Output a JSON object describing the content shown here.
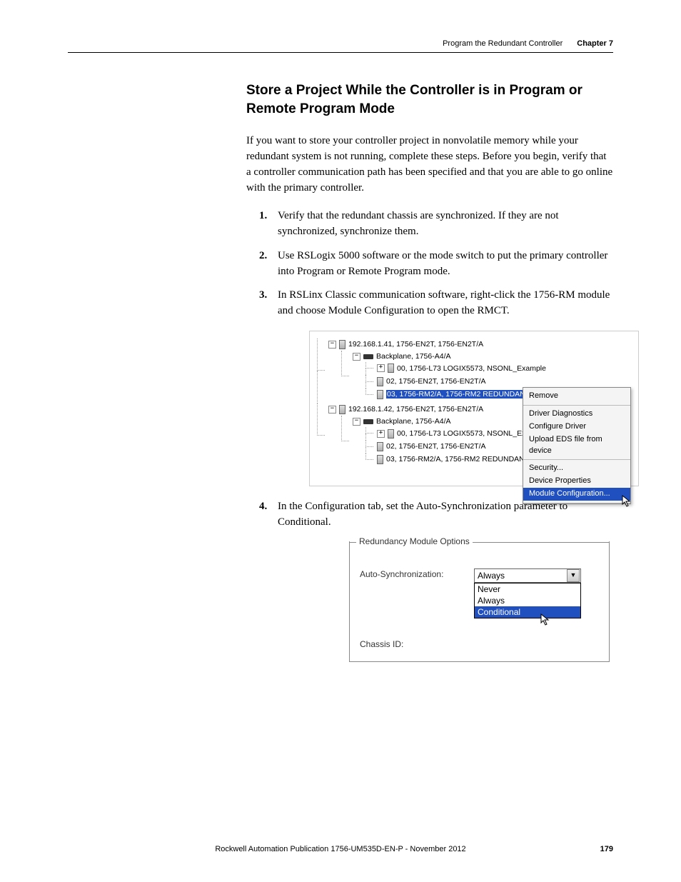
{
  "header": {
    "chapter_title": "Program the Redundant Controller",
    "chapter_label": "Chapter 7"
  },
  "section_title": "Store a Project While the Controller is in Program or Remote Program Mode",
  "intro": "If you want to store your controller project in nonvolatile memory while your redundant system is not running, complete these steps. Before you begin, verify that a controller communication path has been specified and that you are able to go online with the primary controller.",
  "steps": [
    "Verify that the redundant chassis are synchronized. If they are not synchronized, synchronize them.",
    "Use RSLogix 5000 software or the mode switch to put the primary controller into Program or Remote Program mode.",
    "In RSLinx Classic communication software, right-click the 1756-RM module and choose Module Configuration to open the RMCT.",
    "In the Configuration tab, set the Auto-Synchronization parameter to Conditional."
  ],
  "tree": {
    "node1": {
      "label": "192.168.1.41, 1756-EN2T, 1756-EN2T/A",
      "backplane": "Backplane, 1756-A4/A",
      "children": [
        "00, 1756-L73 LOGIX5573, NSONL_Example",
        "02, 1756-EN2T, 1756-EN2T/A",
        "03, 1756-RM2/A, 1756-RM2 REDUNDANCY MODULE"
      ]
    },
    "node2": {
      "label": "192.168.1.42, 1756-EN2T, 1756-EN2T/A",
      "backplane": "Backplane, 1756-A4/A",
      "children": [
        "00, 1756-L73 LOGIX5573, NSONL_Example",
        "02, 1756-EN2T, 1756-EN2T/A",
        "03, 1756-RM2/A, 1756-RM2 REDUNDANCY MODULE"
      ]
    }
  },
  "context_menu": {
    "g1": [
      "Remove"
    ],
    "g2": [
      "Driver Diagnostics",
      "Configure Driver",
      "Upload EDS file from device"
    ],
    "g3": [
      "Security...",
      "Device Properties",
      "Module Configuration..."
    ]
  },
  "options_panel": {
    "legend": "Redundancy Module Options",
    "row1_label": "Auto-Synchronization:",
    "row2_label": "Chassis ID:",
    "selected": "Always",
    "options": [
      "Never",
      "Always",
      "Conditional"
    ]
  },
  "footer": {
    "publication": "Rockwell Automation Publication 1756-UM535D-EN-P - November 2012",
    "page": "179"
  }
}
